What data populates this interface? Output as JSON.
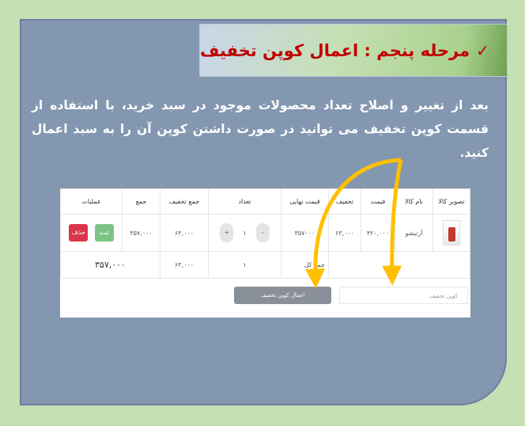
{
  "title": {
    "check": "✓",
    "text": "مرحله پنجم : اعمال کوپن تخفیف"
  },
  "paragraph": "بعد از تغییر و اصلاح تعداد محصولات موجود در سبد خرید، با استفاده از قسمت کوپن تخفیف می توانید در صورت داشتن کوپن آن را به سبد اعمال کنید.",
  "cart": {
    "headers": [
      "تصویر کالا",
      "نام کالا",
      "قیمت",
      "تخفیف",
      "قیمت نهایی",
      "تعداد",
      "جمع تخفیف",
      "جمع",
      "عملیات"
    ],
    "row": {
      "name": "آرتیشو",
      "price": "۴۲۰,۰۰۰",
      "discount": "۶۳,۰۰۰",
      "final": "۳۵۷۰۰۰",
      "qty": "۱",
      "minus": "-",
      "plus": "+",
      "discount_sum": "۶۳,۰۰۰",
      "sum": "۳۵۷,۰۰۰",
      "save": "ثبت",
      "delete": "حذف"
    },
    "total": {
      "label": "جمع کل",
      "qty": "۱",
      "discount_sum": "۶۳,۰۰۰",
      "sum": "۳۵۷,۰۰۰"
    },
    "coupon_placeholder": "کوپن تخفیف",
    "apply_button": "اعمال کوپن تخفیف"
  },
  "colors": {
    "background": "#c5e0b3",
    "panel": "#8497b0",
    "title_text": "#c00000",
    "arrow": "#ffc000"
  }
}
